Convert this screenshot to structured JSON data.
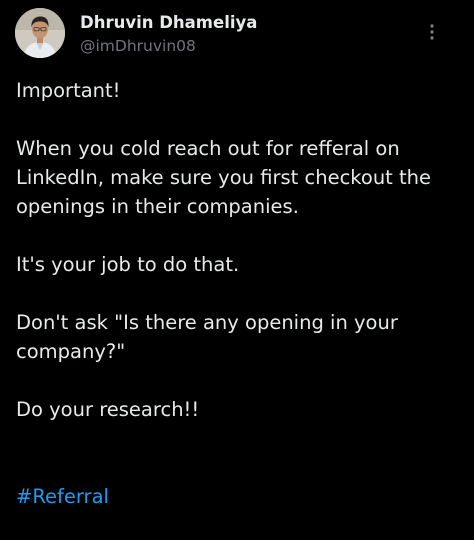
{
  "tweet": {
    "author": {
      "name": "Dhruvin Dhameliya",
      "handle": "@imDhruvin08",
      "avatar_icon": "profile-photo"
    },
    "more_icon": "more-vertical-icon",
    "paragraphs": [
      "Important!",
      "When you cold reach out for refferal on\nLinkedIn, make sure you first checkout the\nopenings in their companies.",
      "It's your job to do that.",
      "Don't ask \"Is there any opening in your\ncompany?\"",
      "Do your research!!"
    ],
    "hashtag": "#Referral"
  },
  "colors": {
    "background": "#000000",
    "text": "#e7e9ea",
    "secondary": "#71767b",
    "accent": "#1d9bf0"
  }
}
